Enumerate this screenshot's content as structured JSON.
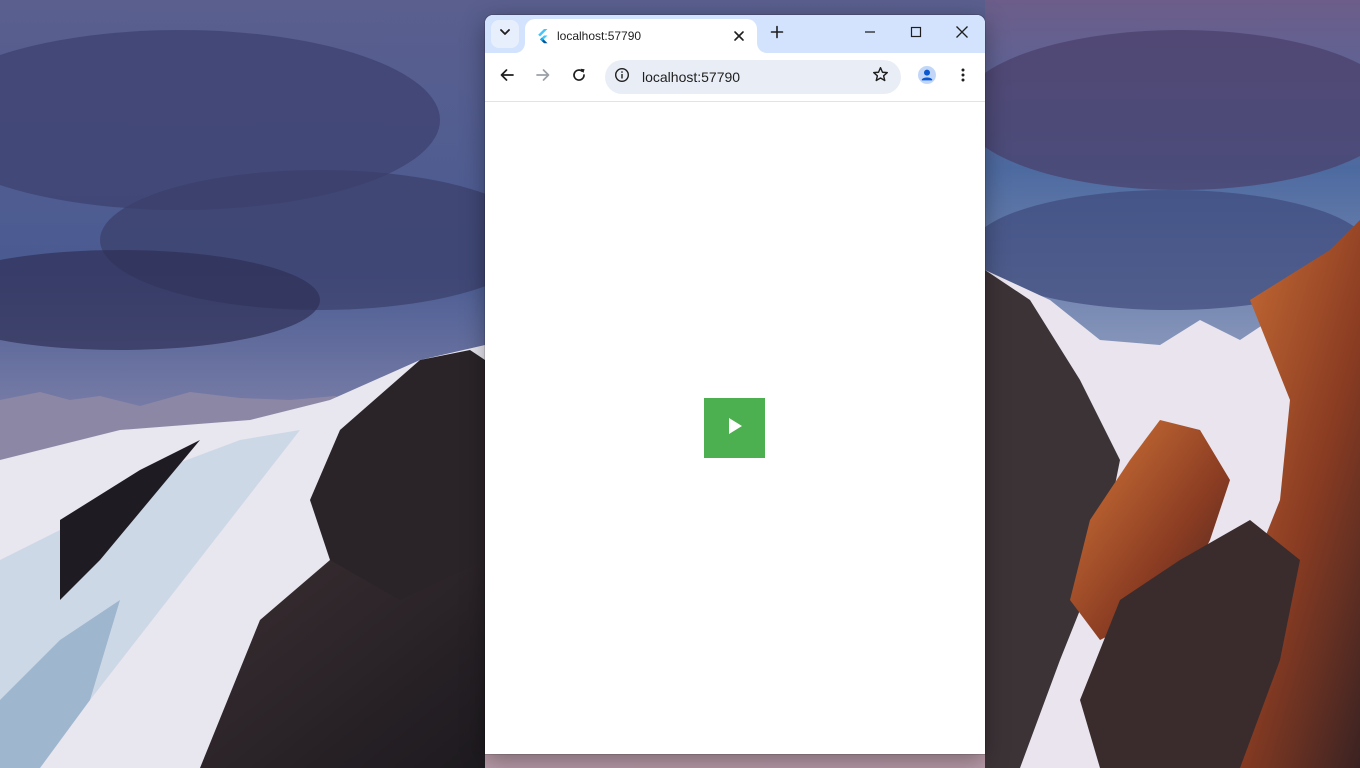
{
  "desktop": {
    "wallpaper": "snowy-mountains-at-sunset"
  },
  "browser": {
    "tab": {
      "title": "localhost:57790",
      "favicon": "flutter-icon"
    },
    "address_bar": {
      "url": "localhost:57790"
    },
    "icons": {
      "tab_search": "chevron-down-icon",
      "tab_close": "close-icon",
      "new_tab": "plus-icon",
      "minimize": "minimize-icon",
      "maximize": "maximize-icon",
      "close_window": "close-icon",
      "back": "arrow-left-icon",
      "forward": "arrow-right-icon",
      "reload": "reload-icon",
      "site_info": "info-icon",
      "bookmark": "star-icon",
      "profile": "person-icon",
      "menu": "more-vert-icon"
    },
    "colors": {
      "tabstrip": "#d3e3fd",
      "omnibox": "#e9eef6",
      "profile_accent": "#0b57d0"
    }
  },
  "page": {
    "play_button": {
      "icon": "play-icon",
      "color": "#4caf50"
    }
  }
}
